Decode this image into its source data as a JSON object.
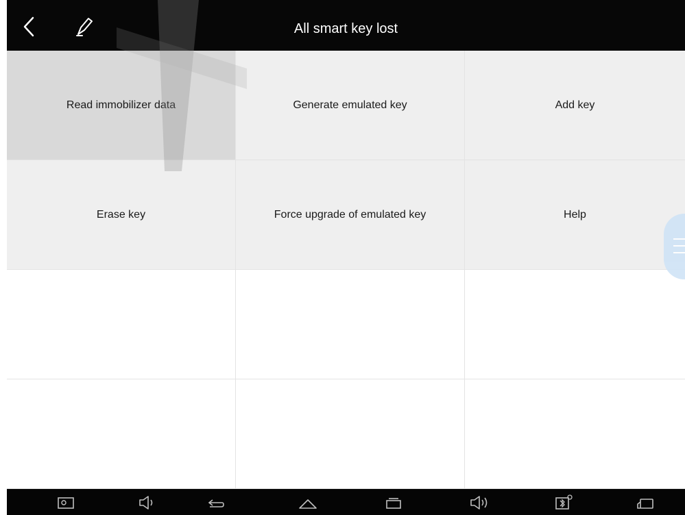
{
  "header": {
    "title": "All smart key lost"
  },
  "menu": {
    "items": [
      {
        "label": "Read immobilizer data",
        "state": "selected"
      },
      {
        "label": "Generate emulated key",
        "state": "normal"
      },
      {
        "label": "Add key",
        "state": "normal"
      },
      {
        "label": "Erase key",
        "state": "normal"
      },
      {
        "label": "Force upgrade of emulated key",
        "state": "normal"
      },
      {
        "label": "Help",
        "state": "normal"
      }
    ]
  },
  "icons": {
    "back": "back-arrow-icon",
    "edit": "pen-icon",
    "floating": "floating-menu-icon",
    "nav": [
      "screenshot-icon",
      "volume-down-icon",
      "back-icon",
      "home-icon",
      "recent-apps-icon",
      "volume-up-icon",
      "vci-bluetooth-icon",
      "vehicle-connection-icon"
    ]
  },
  "colors": {
    "header_bg": "#070707",
    "cell_bg": "#efefef",
    "selected_bg": "#d9d9d9",
    "nav_bg": "#050505",
    "float_button": "#cfe3f6"
  }
}
